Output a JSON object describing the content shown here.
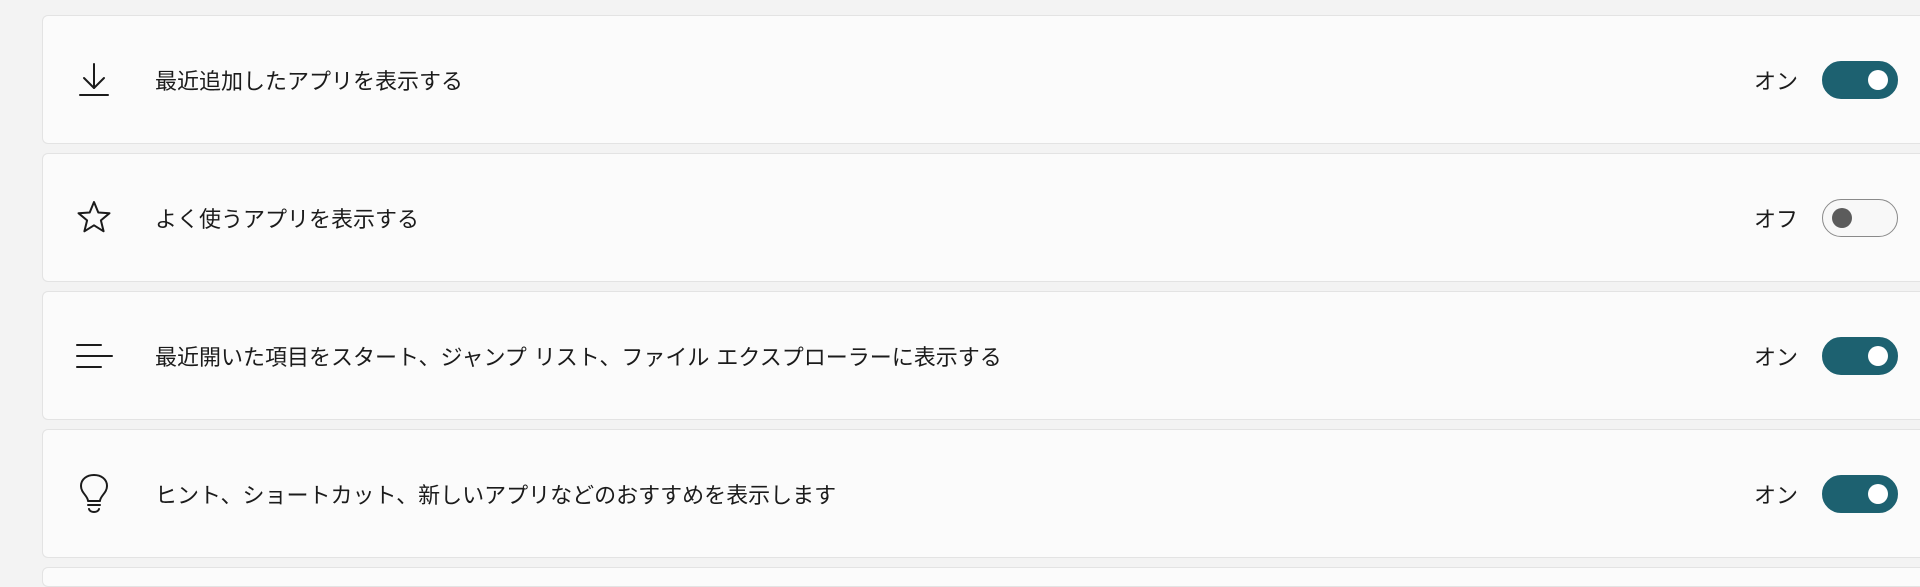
{
  "settings": [
    {
      "icon": "download-icon",
      "label": "最近追加したアプリを表示する",
      "state_label": "オン",
      "on": true
    },
    {
      "icon": "star-icon",
      "label": "よく使うアプリを表示する",
      "state_label": "オフ",
      "on": false
    },
    {
      "icon": "list-lines-icon",
      "label": "最近開いた項目をスタート、ジャンプ リスト、ファイル エクスプローラーに表示する",
      "state_label": "オン",
      "on": true
    },
    {
      "icon": "lightbulb-icon",
      "label": "ヒント、ショートカット、新しいアプリなどのおすすめを表示します",
      "state_label": "オン",
      "on": true
    }
  ],
  "colors": {
    "toggle_on": "#1d6170",
    "toggle_off_knob": "#5c5c5c",
    "card_bg": "#fbfbfb",
    "page_bg": "#f3f3f3"
  }
}
